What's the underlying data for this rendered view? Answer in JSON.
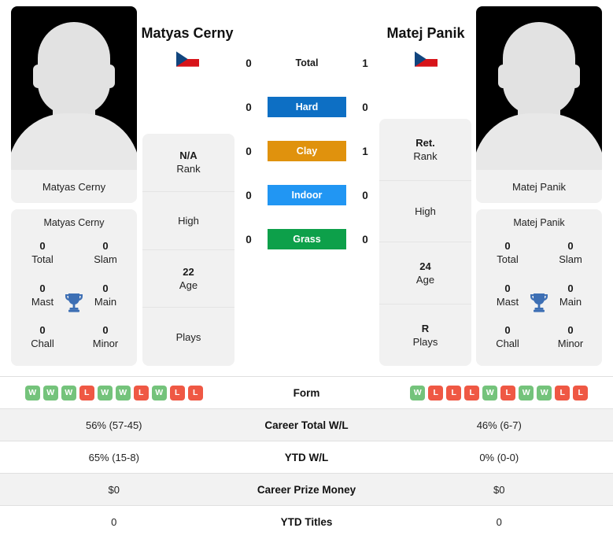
{
  "players": {
    "left": {
      "name": "Matyas Cerny",
      "photo_name": "Matyas Cerny",
      "flag": "czech-republic-flag",
      "titles_name": "Matyas Cerny",
      "titles": [
        {
          "value": "0",
          "label": "Total"
        },
        {
          "value": "0",
          "label": "Slam"
        },
        {
          "value": "0",
          "label": "Mast"
        },
        {
          "value": "0",
          "label": "Main"
        },
        {
          "value": "0",
          "label": "Chall"
        },
        {
          "value": "0",
          "label": "Minor"
        }
      ],
      "info": [
        {
          "value": "N/A",
          "label": "Rank"
        },
        {
          "value": "",
          "label": "High"
        },
        {
          "value": "22",
          "label": "Age"
        },
        {
          "value": "",
          "label": "Plays"
        }
      ]
    },
    "right": {
      "name": "Matej Panik",
      "photo_name": "Matej Panik",
      "flag": "czech-republic-flag",
      "titles_name": "Matej Panik",
      "titles": [
        {
          "value": "0",
          "label": "Total"
        },
        {
          "value": "0",
          "label": "Slam"
        },
        {
          "value": "0",
          "label": "Mast"
        },
        {
          "value": "0",
          "label": "Main"
        },
        {
          "value": "0",
          "label": "Chall"
        },
        {
          "value": "0",
          "label": "Minor"
        }
      ],
      "info": [
        {
          "value": "Ret.",
          "label": "Rank"
        },
        {
          "value": "",
          "label": "High"
        },
        {
          "value": "24",
          "label": "Age"
        },
        {
          "value": "R",
          "label": "Plays"
        }
      ]
    }
  },
  "h2h": [
    {
      "label": "Total",
      "left": "0",
      "right": "1",
      "pill": false,
      "color": ""
    },
    {
      "label": "Hard",
      "left": "0",
      "right": "0",
      "pill": true,
      "color": "#0d6fc4"
    },
    {
      "label": "Clay",
      "left": "0",
      "right": "1",
      "pill": true,
      "color": "#e0920d"
    },
    {
      "label": "Indoor",
      "left": "0",
      "right": "0",
      "pill": true,
      "color": "#2196f3"
    },
    {
      "label": "Grass",
      "left": "0",
      "right": "0",
      "pill": true,
      "color": "#0da04a"
    }
  ],
  "stats": {
    "form": {
      "label": "Form",
      "left": [
        "W",
        "W",
        "W",
        "L",
        "W",
        "W",
        "L",
        "W",
        "L",
        "L"
      ],
      "right": [
        "W",
        "L",
        "L",
        "L",
        "W",
        "L",
        "W",
        "W",
        "L",
        "L"
      ]
    },
    "rows": [
      {
        "label": "Career Total W/L",
        "left": "56% (57-45)",
        "right": "46% (6-7)"
      },
      {
        "label": "YTD W/L",
        "left": "65% (15-8)",
        "right": "0% (0-0)"
      },
      {
        "label": "Career Prize Money",
        "left": "$0",
        "right": "$0"
      },
      {
        "label": "YTD Titles",
        "left": "0",
        "right": "0"
      }
    ]
  },
  "colors": {
    "win": "#74c37b",
    "loss": "#ef5844",
    "trophy": "#3d6fb4",
    "card_bg": "#f1f1f1",
    "row_shade": "#f2f2f2"
  }
}
